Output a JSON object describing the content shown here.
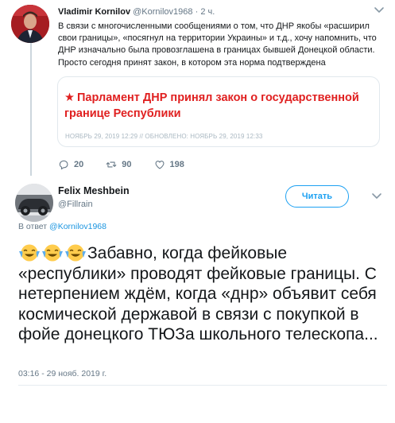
{
  "parent_tweet": {
    "author_name": "Vladimir Kornilov",
    "author_handle": "@Kornilov1968",
    "separator": "·",
    "time": "2 ч.",
    "text": "В связи с многочисленными сообщениями о том, что ДНР якобы «расширил свои границы», «посягнул на территории Украины» и т.д., хочу напомнить, что ДНР изначально была провозглашена в границах бывшей Донецкой области. Просто сегодня принят закон, в котором эта норма подтверждена",
    "card": {
      "star": "★",
      "title": "Парламент ДНР принял закон о государственной границе Республики",
      "meta": "НОЯБРЬ 29, 2019 12:29 // ОБНОВЛЕНО: НОЯБРЬ 29, 2019 12:33"
    },
    "actions": {
      "replies": "20",
      "retweets": "90",
      "likes": "198"
    }
  },
  "main_tweet": {
    "author_name": "Felix Meshbein",
    "author_handle": "@Fillrain",
    "follow_label": "Читать",
    "reply_prefix": "В ответ",
    "reply_target": "@Kornilov1968",
    "emoji": [
      "face-with-tears-of-joy",
      "face-with-tears-of-joy",
      "face-with-tears-of-joy"
    ],
    "text": "Забавно, когда фейковые «республики» проводят фейковые границы. С нетерпением ждём, когда «днр» объявит себя космической державой в связи с покупкой в фойе донецкого ТЮЗа школьного телескопа...",
    "timestamp": "03:16 - 29 нояб. 2019 г."
  },
  "colors": {
    "accent": "#1da1f2",
    "card_title": "#e02020",
    "muted": "#657786"
  }
}
